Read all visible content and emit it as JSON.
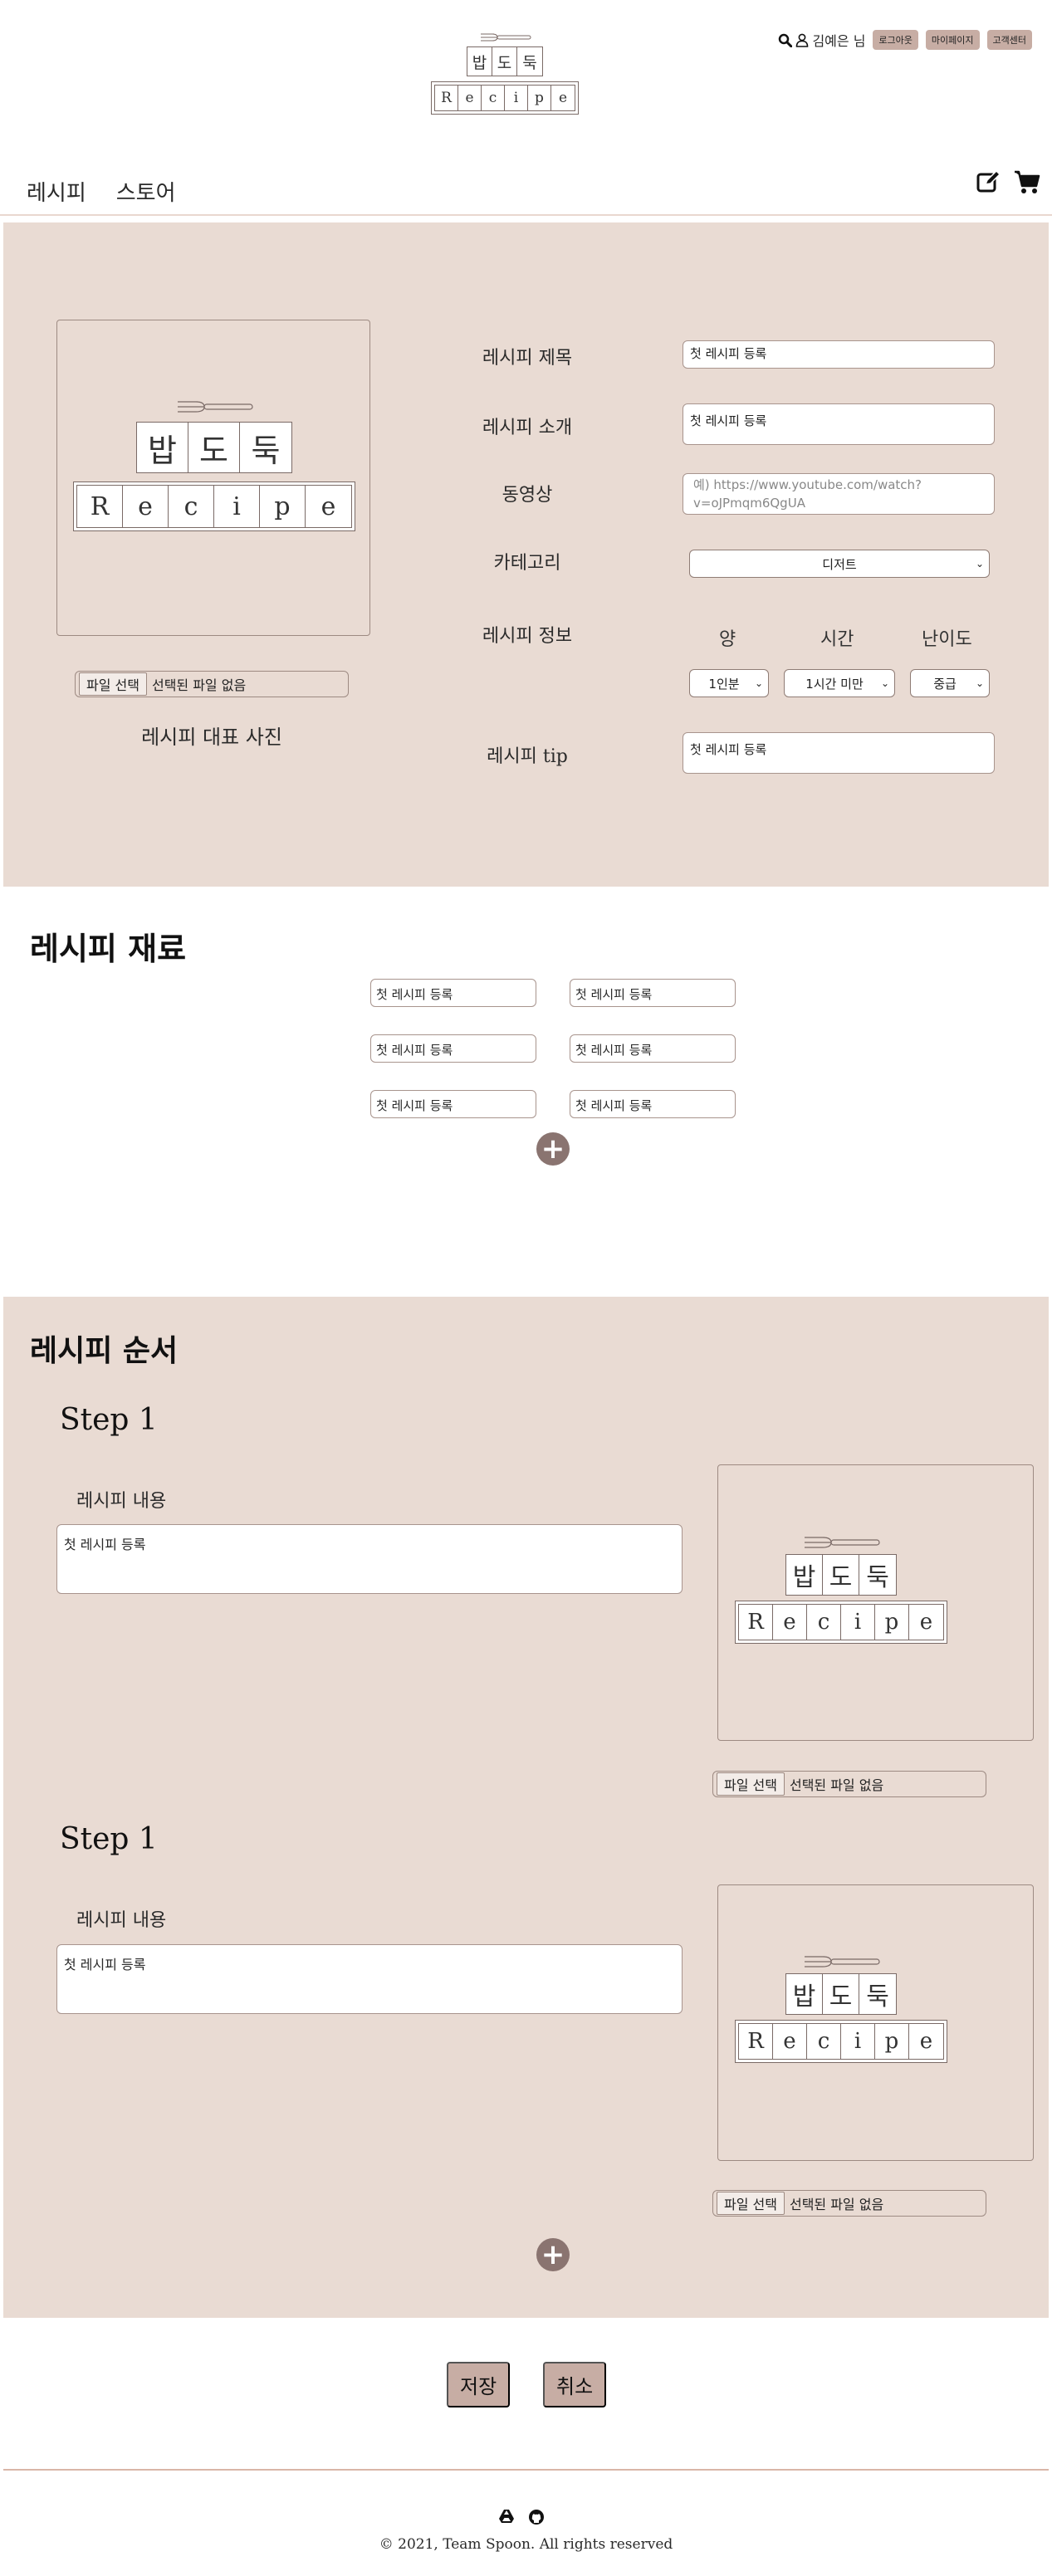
{
  "header": {
    "logo": {
      "korean": [
        "밥",
        "도",
        "둑"
      ],
      "english": [
        "R",
        "e",
        "c",
        "i",
        "p",
        "e"
      ]
    },
    "user_label": "김예은 님",
    "buttons": [
      "로그아웃",
      "마이페이지",
      "고객센터"
    ],
    "nav": [
      "레시피",
      "스토어"
    ]
  },
  "recipe_info": {
    "photo_logo": {
      "korean": [
        "밥",
        "도",
        "둑"
      ],
      "english": [
        "R",
        "e",
        "c",
        "i",
        "p",
        "e"
      ]
    },
    "file_button": "파일 선택",
    "file_status": "선택된 파일 없음",
    "photo_caption": "레시피 대표 사진",
    "title_label": "레시피 제목",
    "title_value": "첫 레시피 등록",
    "intro_label": "레시피 소개",
    "intro_value": "첫 레시피 등록",
    "video_label": "동영상",
    "video_placeholder": "예) https://www.youtube.com/watch?v=oJPmqm6QgUA",
    "category_label": "카테고리",
    "category_value": "디저트",
    "info_label": "레시피 정보",
    "info_headers": [
      "양",
      "시간",
      "난이도"
    ],
    "info_values": [
      "1인분",
      "1시간 미만",
      "중급"
    ],
    "tip_label": "레시피 tip",
    "tip_value": "첫 레시피 등록"
  },
  "ingredients": {
    "title": "레시피 재료",
    "items": [
      "첫 레시피 등록",
      "첫 레시피 등록",
      "첫 레시피 등록",
      "첫 레시피 등록",
      "첫 레시피 등록",
      "첫 레시피 등록"
    ]
  },
  "steps": {
    "title": "레시피 순서",
    "items": [
      {
        "title": "Step 1",
        "content_label": "레시피 내용",
        "content": "첫 레시피 등록",
        "file_button": "파일 선택",
        "file_status": "선택된 파일 없음"
      },
      {
        "title": "Step 1",
        "content_label": "레시피 내용",
        "content": "첫 레시피 등록",
        "file_button": "파일 선택",
        "file_status": "선택된 파일 없음"
      }
    ]
  },
  "actions": {
    "save": "저장",
    "cancel": "취소"
  },
  "footer": {
    "copyright": "© 2021, Team Spoon. All rights reserved"
  },
  "colors": {
    "panel": "#e9dbd3",
    "accent": "#c7ada4",
    "add_button": "#8a7470"
  }
}
